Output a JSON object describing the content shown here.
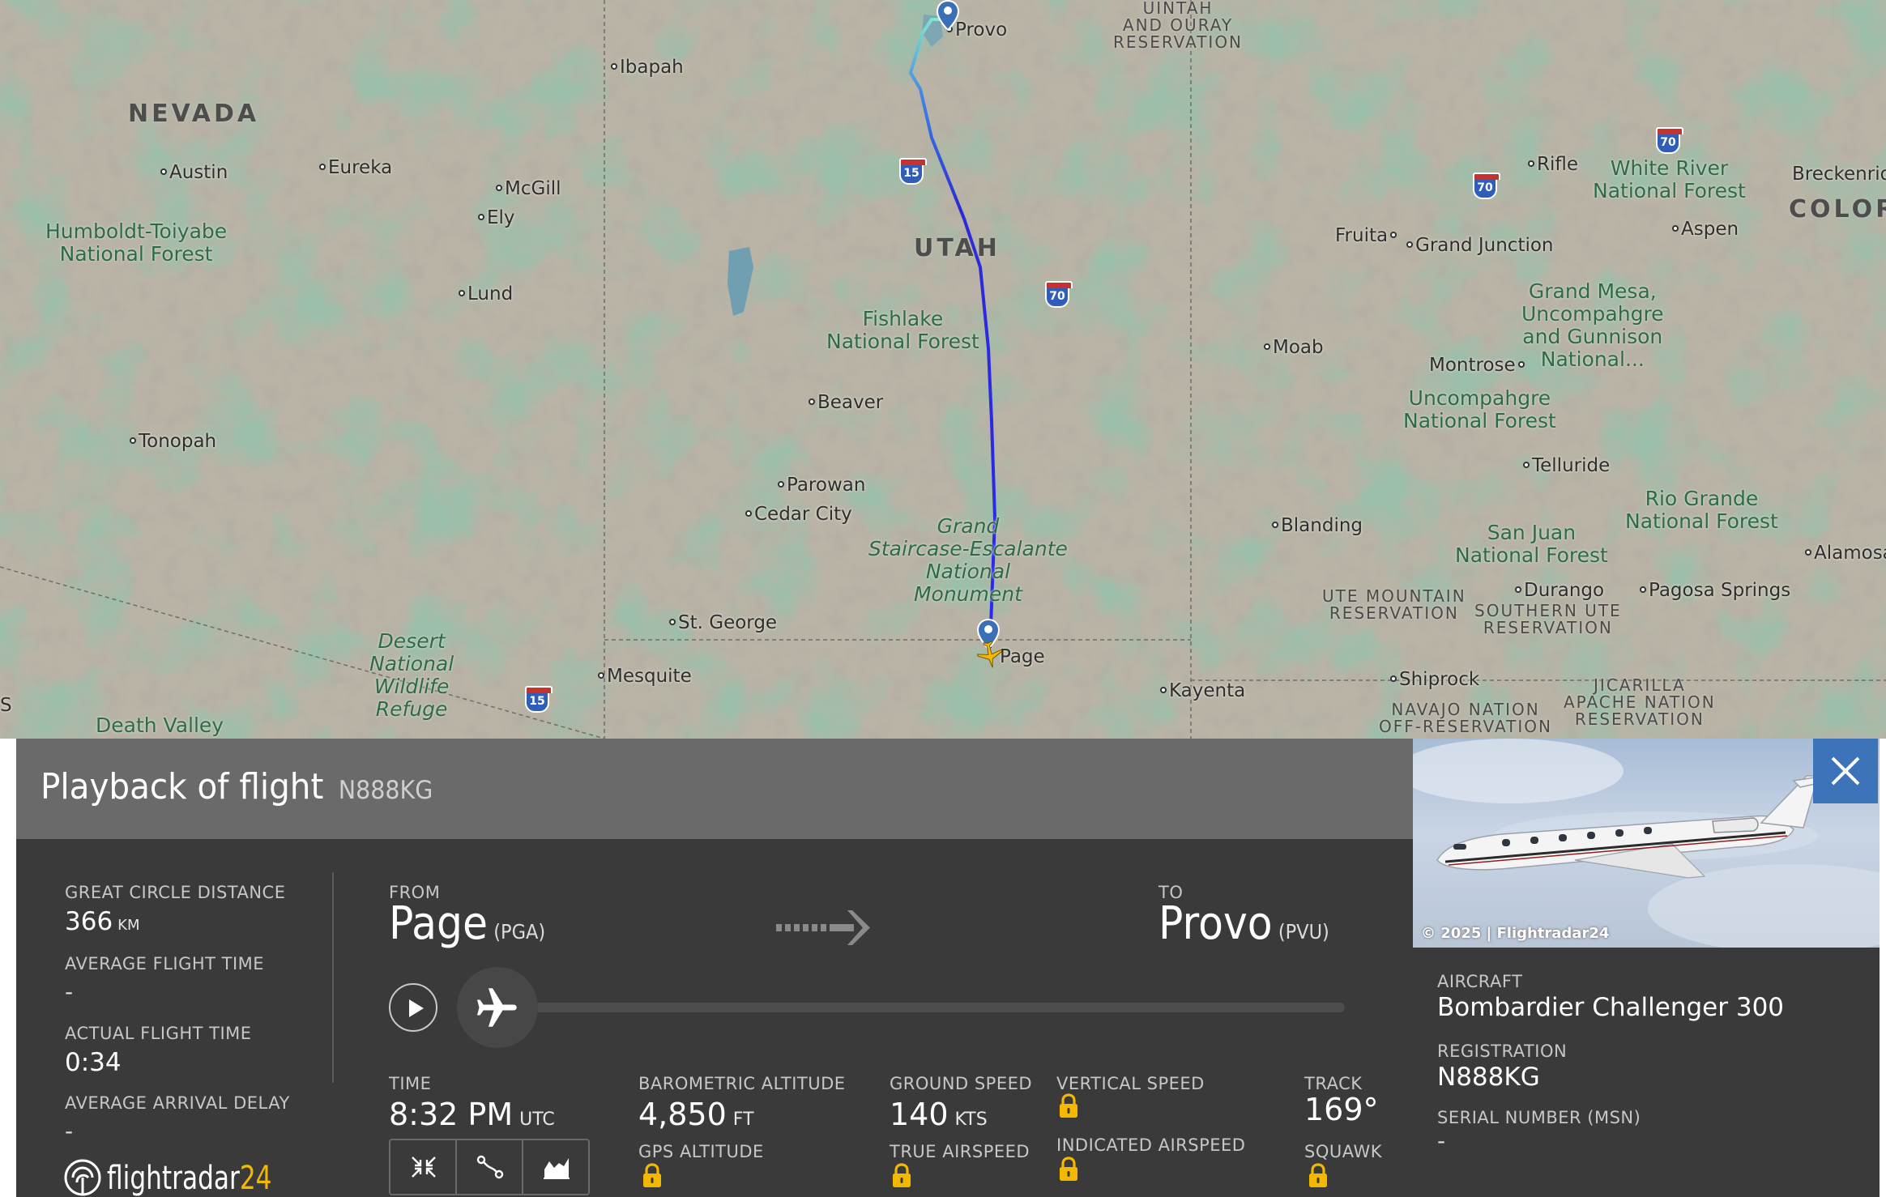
{
  "map": {
    "states": [
      {
        "id": "nevada",
        "label": "NEVADA"
      },
      {
        "id": "utah",
        "label": "UTAH"
      },
      {
        "id": "colorado",
        "label": "COLOR"
      }
    ],
    "places": [
      "Provo",
      "Ibapah",
      "Austin",
      "Eureka",
      "McGill",
      "Ely",
      "Lund",
      "Tonopah",
      "Beaver",
      "Parowan",
      "Cedar City",
      "St. George",
      "Mesquite",
      "Page",
      "Kayenta",
      "Blanding",
      "Moab",
      "Fruita",
      "Grand Junction",
      "Rifle",
      "Aspen",
      "Breckenrid",
      "Montrose",
      "Telluride",
      "Durango",
      "Pagosa Springs",
      "Alamosa",
      "Shiprock"
    ],
    "parks": {
      "humboldt": "Humboldt-Toiyabe\nNational Forest",
      "fishlake": "Fishlake\nNational Forest",
      "grand_staircase": "Grand\nStaircase-Escalante\nNational\nMonument",
      "desert": "Desert\nNational\nWildlife\nRefuge",
      "death_valley": "Death Valley",
      "white_river": "White River\nNational Forest",
      "gmug": "Grand Mesa,\nUncompahgre\nand Gunnison\nNational...",
      "uncompahgre": "Uncompahgre\nNational Forest",
      "san_juan": "San Juan\nNational Forest",
      "rio_grande": "Rio Grande\nNational Forest"
    },
    "reservations": {
      "uintah": "UINTAH\nAND OURAY\nRESERVATION",
      "ute_mountain": "UTE MOUNTAIN\nRESERVATION",
      "southern_ute": "SOUTHERN UTE\nRESERVATION",
      "jicarilla": "JICARILLA\nAPACHE NATION\nRESERVATION",
      "navajo": "NAVAJO NATION\nOFF-RESERVATION"
    },
    "highways": [
      "15",
      "70",
      "70",
      "70",
      "15"
    ],
    "s_edge": "S"
  },
  "playback": {
    "title": "Playback of flight",
    "registration": "N888KG",
    "great_circle_distance_label": "GREAT CIRCLE DISTANCE",
    "great_circle_distance_value": "366",
    "great_circle_distance_unit": "KM",
    "average_flight_time_label": "AVERAGE FLIGHT TIME",
    "average_flight_time_value": "-",
    "actual_flight_time_label": "ACTUAL FLIGHT TIME",
    "actual_flight_time_value": "0:34",
    "average_arrival_delay_label": "AVERAGE ARRIVAL DELAY",
    "average_arrival_delay_value": "-",
    "from_label": "FROM",
    "from_city": "Page",
    "from_code": "(PGA)",
    "to_label": "TO",
    "to_city": "Provo",
    "to_code": "(PVU)",
    "progress": 0.0,
    "time_label": "TIME",
    "time_value": "8:32 PM",
    "time_unit": "UTC",
    "baro_alt_label": "BAROMETRIC ALTITUDE",
    "baro_alt_value": "4,850",
    "baro_alt_unit": "FT",
    "gps_alt_label": "GPS ALTITUDE",
    "ground_speed_label": "GROUND SPEED",
    "ground_speed_value": "140",
    "ground_speed_unit": "KTS",
    "true_airspeed_label": "TRUE AIRSPEED",
    "vertical_speed_label": "VERTICAL SPEED",
    "indicated_airspeed_label": "INDICATED AIRSPEED",
    "track_label": "TRACK",
    "track_value": "169°",
    "squawk_label": "SQUAWK",
    "logo_text": "flightradar",
    "logo_num": "24"
  },
  "aircraft": {
    "photo_credit": "© 2025 | Flightradar24",
    "aircraft_label": "AIRCRAFT",
    "aircraft_value": "Bombardier Challenger 300",
    "registration_label": "REGISTRATION",
    "registration_value": "N888KG",
    "serial_label": "SERIAL NUMBER (MSN)",
    "serial_value": "-"
  },
  "colors": {
    "panel_bg": "#3a3a3a",
    "header_bg": "#6a6a6a",
    "close_bg": "#3d73b8",
    "route_start": "#1c1cdc",
    "route_end": "#6fe0d0",
    "lock": "#f5b800"
  }
}
